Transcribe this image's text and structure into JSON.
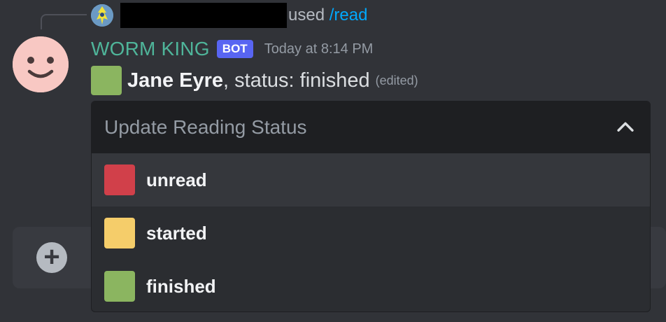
{
  "reply": {
    "used_text": "used",
    "command": "/read"
  },
  "message": {
    "username": "WORM KING",
    "badge": "BOT",
    "timestamp": "Today at 8:14 PM",
    "book_title": "Jane Eyre",
    "status_text": ", status: finished",
    "edited_label": "(edited)",
    "status_color": "#8bb560"
  },
  "dropdown": {
    "placeholder": "Update Reading Status",
    "options": [
      {
        "label": "unread",
        "color": "#d1404a"
      },
      {
        "label": "started",
        "color": "#f5cd6a"
      },
      {
        "label": "finished",
        "color": "#8bb560"
      }
    ]
  },
  "colors": {
    "background": "#313338",
    "accent_bot_badge": "#5865f2",
    "username": "#4fb59a",
    "command_link": "#00a8fc"
  },
  "icons": {
    "avatar": "smiley-face-icon",
    "dropdown_toggle": "chevron-up-icon",
    "composer_add": "plus-circle-icon"
  }
}
